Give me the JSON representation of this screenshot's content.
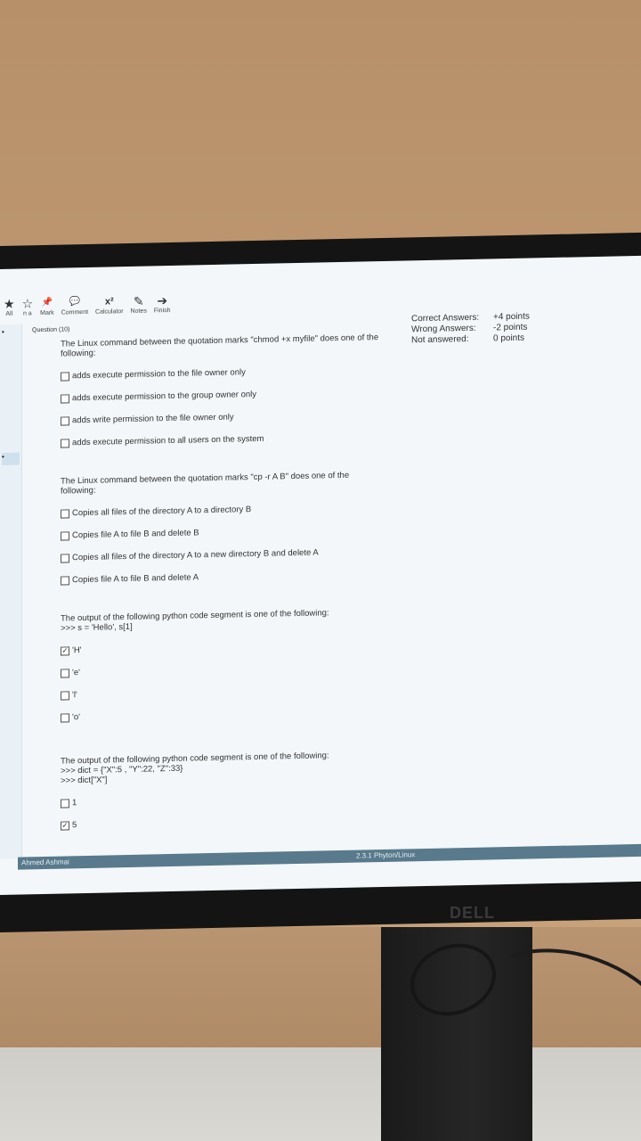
{
  "toolbar": {
    "items": [
      {
        "label": "All",
        "icon": "star-icon",
        "glyph": "★"
      },
      {
        "label": "n a",
        "icon": "star-outline-icon",
        "glyph": "☆"
      },
      {
        "label": "Mark",
        "icon": "pin-icon",
        "glyph": "📌"
      },
      {
        "label": "Comment",
        "icon": "comment-icon",
        "glyph": "💬"
      },
      {
        "label": "Calculator",
        "icon": "calculator-icon",
        "glyph": "x²"
      },
      {
        "label": "Notes",
        "icon": "notes-icon",
        "glyph": "✎"
      },
      {
        "label": "Finish",
        "icon": "finish-icon",
        "glyph": "➔"
      }
    ]
  },
  "question_header": "Question (10)",
  "scoring": {
    "correct_label": "Correct Answers:",
    "correct_points": "+4 points",
    "wrong_label": "Wrong Answers:",
    "wrong_points": "-2 points",
    "unanswered_label": "Not answered:",
    "unanswered_points": "0 points"
  },
  "questions": [
    {
      "text": "The Linux command between the quotation marks \"chmod +x myfile\" does one of the\nfollowing:",
      "options": [
        {
          "label": "adds execute permission to the file owner only",
          "checked": false
        },
        {
          "label": "adds execute permission to the group owner only",
          "checked": false
        },
        {
          "label": "adds write permission to the file owner only",
          "checked": false
        },
        {
          "label": "adds execute permission to all users on the system",
          "checked": false
        }
      ]
    },
    {
      "text": "The Linux command between the quotation marks \"cp -r A B\" does one of the\nfollowing:",
      "options": [
        {
          "label": "Copies all files of the directory A to a directory B",
          "checked": false
        },
        {
          "label": "Copies file A to file B and delete B",
          "checked": false
        },
        {
          "label": "Copies all files of the directory A to a new directory B and delete A",
          "checked": false
        },
        {
          "label": "Copies file A to file B and delete A",
          "checked": false
        }
      ]
    },
    {
      "text": "The output of the following python code segment is one of the following:\n>>> s = 'Hello', s[1]",
      "options": [
        {
          "label": "'H'",
          "checked": true
        },
        {
          "label": "'e'",
          "checked": false
        },
        {
          "label": "'l'",
          "checked": false
        },
        {
          "label": "'o'",
          "checked": false
        }
      ]
    },
    {
      "text": "The output of the following python code segment is one of the following:\n>>> dict = {\"X\":5 , \"Y\":22, \"Z\":33}\n>>> dict[\"X\"]",
      "options": [
        {
          "label": "1",
          "checked": false
        },
        {
          "label": "5",
          "checked": true
        }
      ]
    }
  ],
  "status_bar": {
    "user": "Ahmed Ashmai",
    "version": "2.3.1 Phyton/Linux"
  },
  "monitor_brand": "DELL"
}
